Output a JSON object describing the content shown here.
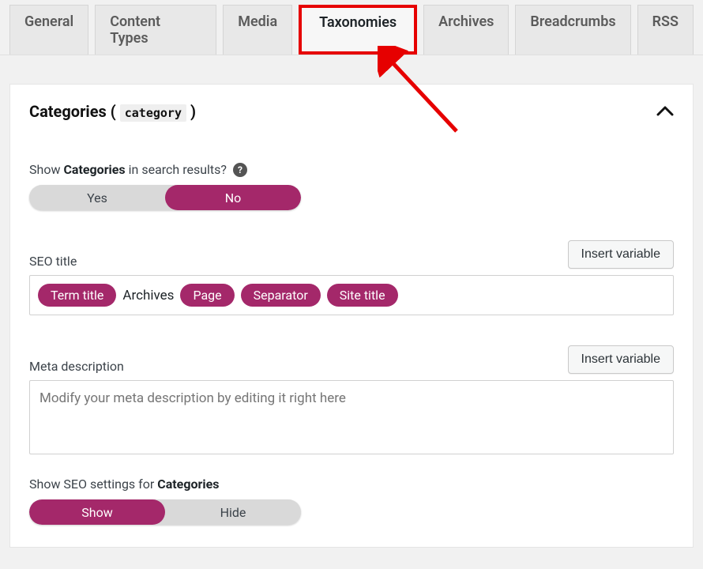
{
  "tabs": {
    "general": "General",
    "content_types": "Content Types",
    "media": "Media",
    "taxonomies": "Taxonomies",
    "archives": "Archives",
    "breadcrumbs": "Breadcrumbs",
    "rss": "RSS"
  },
  "section": {
    "title_prefix": "Categories",
    "slug": "category",
    "open_paren": "(",
    "close_paren": ")"
  },
  "show_in_search": {
    "label_prefix": "Show ",
    "label_strong": "Categories",
    "label_suffix": " in search results?",
    "help_char": "?",
    "yes": "Yes",
    "no": "No"
  },
  "seo_title": {
    "label": "SEO title",
    "insert_btn": "Insert variable",
    "tokens": {
      "term_title": "Term title",
      "archives_plain": "Archives",
      "page": "Page",
      "separator": "Separator",
      "site_title": "Site title"
    }
  },
  "meta_desc": {
    "label": "Meta description",
    "insert_btn": "Insert variable",
    "placeholder": "Modify your meta description by editing it right here"
  },
  "show_settings": {
    "label_prefix": "Show SEO settings for ",
    "label_strong": "Categories",
    "show": "Show",
    "hide": "Hide"
  }
}
